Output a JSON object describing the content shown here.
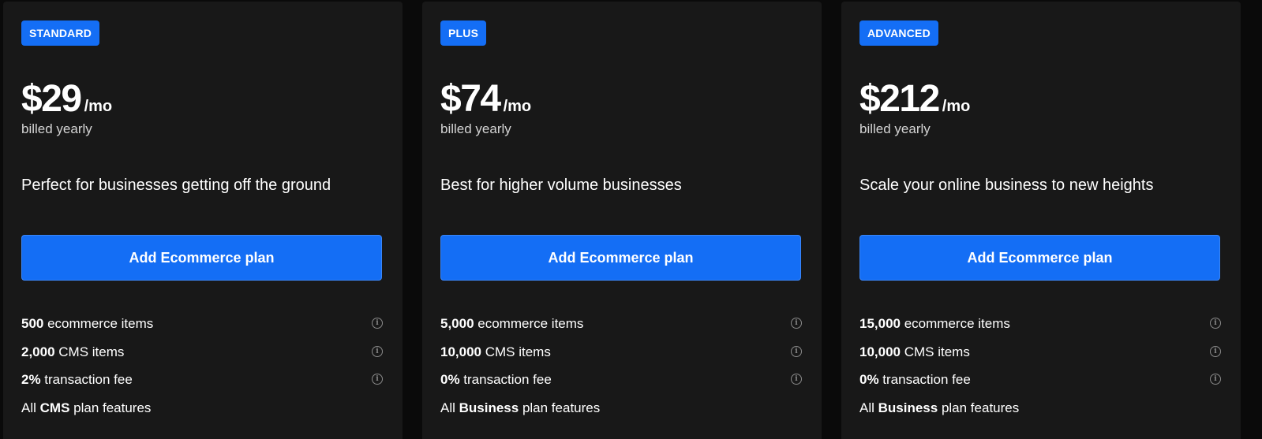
{
  "plans": [
    {
      "badge": "STANDARD",
      "price": "$29",
      "period": "/mo",
      "billing": "billed yearly",
      "tagline": "Perfect for businesses getting off the ground",
      "cta": "Add Ecommerce plan",
      "features": [
        {
          "strong": "500",
          "text": " ecommerce items",
          "info": true
        },
        {
          "strong": "2,000",
          "text": " CMS items",
          "info": true
        },
        {
          "strong": "2%",
          "text": " transaction fee",
          "info": true
        },
        {
          "pre": "All ",
          "strong": "CMS",
          "text": " plan features",
          "info": false
        }
      ]
    },
    {
      "badge": "PLUS",
      "price": "$74",
      "period": "/mo",
      "billing": "billed yearly",
      "tagline": "Best for higher volume businesses",
      "cta": "Add Ecommerce plan",
      "features": [
        {
          "strong": "5,000",
          "text": " ecommerce items",
          "info": true
        },
        {
          "strong": "10,000",
          "text": " CMS items",
          "info": true
        },
        {
          "strong": "0%",
          "text": " transaction fee",
          "info": true
        },
        {
          "pre": "All ",
          "strong": "Business",
          "text": " plan features",
          "info": false
        }
      ]
    },
    {
      "badge": "ADVANCED",
      "price": "$212",
      "period": "/mo",
      "billing": "billed yearly",
      "tagline": "Scale your online business to new heights",
      "cta": "Add Ecommerce plan",
      "features": [
        {
          "strong": "15,000",
          "text": " ecommerce items",
          "info": true
        },
        {
          "strong": "10,000",
          "text": " CMS items",
          "info": true
        },
        {
          "strong": "0%",
          "text": " transaction fee",
          "info": true
        },
        {
          "pre": "All ",
          "strong": "Business",
          "text": " plan features",
          "info": false
        }
      ]
    }
  ],
  "icons": {
    "info": "info-circle-icon",
    "info_glyph": "i"
  },
  "colors": {
    "accent": "#146ef5",
    "card_bg": "#181818",
    "page_bg": "#0a0a0a"
  }
}
